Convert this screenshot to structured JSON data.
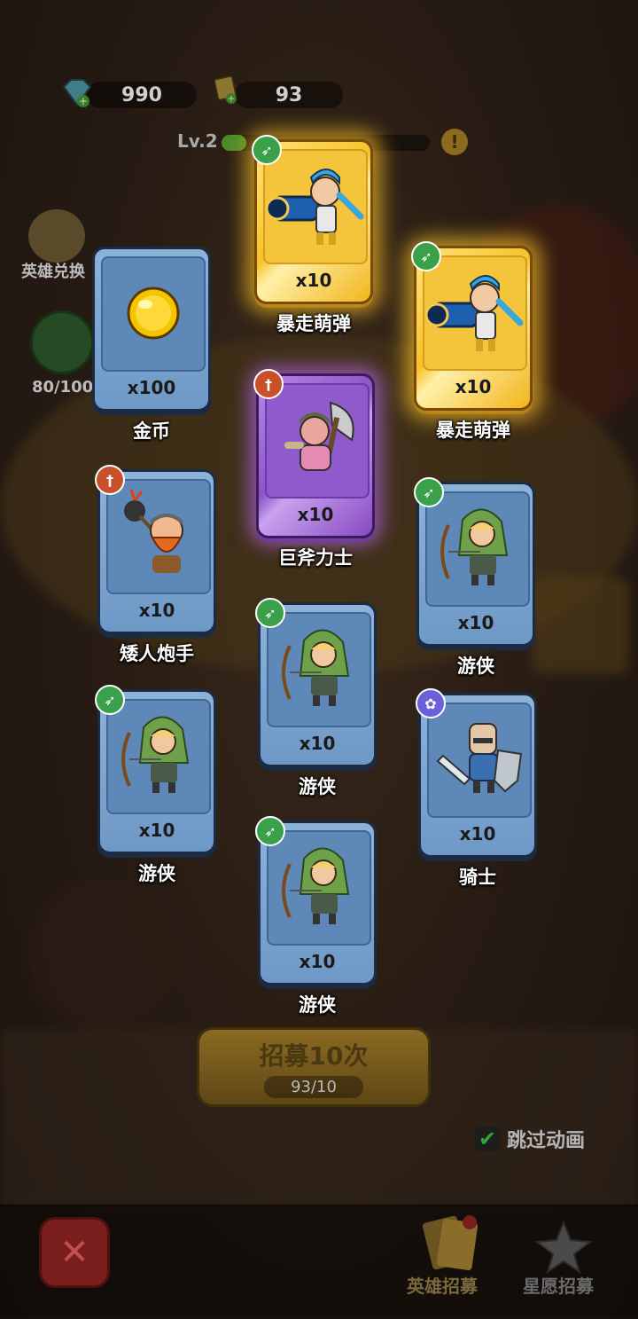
{
  "hud": {
    "gems": "990",
    "tickets": "93",
    "level": "Lv.2",
    "level_progress": 0.12,
    "side_top_label": "英雄兑换",
    "side_progress": "80/100"
  },
  "cards": [
    {
      "id": "gold",
      "name": "金币",
      "qty": "x100",
      "type": "coin",
      "rarity": "blue"
    },
    {
      "id": "bz1",
      "name": "暴走萌弹",
      "qty": "x10",
      "type": "gunner",
      "rarity": "gold",
      "class": "ranger"
    },
    {
      "id": "bz2",
      "name": "暴走萌弹",
      "qty": "x10",
      "type": "gunner",
      "rarity": "gold",
      "class": "ranger"
    },
    {
      "id": "jf",
      "name": "巨斧力士",
      "qty": "x10",
      "type": "axe",
      "rarity": "purple",
      "class": "warrior"
    },
    {
      "id": "ar",
      "name": "矮人炮手",
      "qty": "x10",
      "type": "dwarf",
      "rarity": "blue",
      "class": "warrior"
    },
    {
      "id": "yx1",
      "name": "游侠",
      "qty": "x10",
      "type": "archer",
      "rarity": "blue",
      "class": "ranger"
    },
    {
      "id": "yx2",
      "name": "游侠",
      "qty": "x10",
      "type": "archer",
      "rarity": "blue",
      "class": "ranger"
    },
    {
      "id": "yx3",
      "name": "游侠",
      "qty": "x10",
      "type": "archer",
      "rarity": "blue",
      "class": "ranger"
    },
    {
      "id": "qs",
      "name": "骑士",
      "qty": "x10",
      "type": "knight",
      "rarity": "blue",
      "class": "tank"
    },
    {
      "id": "yx4",
      "name": "游侠",
      "qty": "x10",
      "type": "archer",
      "rarity": "blue",
      "class": "ranger"
    }
  ],
  "recruit": {
    "label": "招募10次",
    "count": "93/10"
  },
  "skip": {
    "label": "跳过动画",
    "checked": true
  },
  "nav": {
    "hero_recruit": "英雄招募",
    "star_recruit": "星愿招募"
  },
  "colors": {
    "gold_card": "#f6c22b",
    "purple_card": "#8c55c8",
    "blue_card": "#7ea6d0"
  }
}
